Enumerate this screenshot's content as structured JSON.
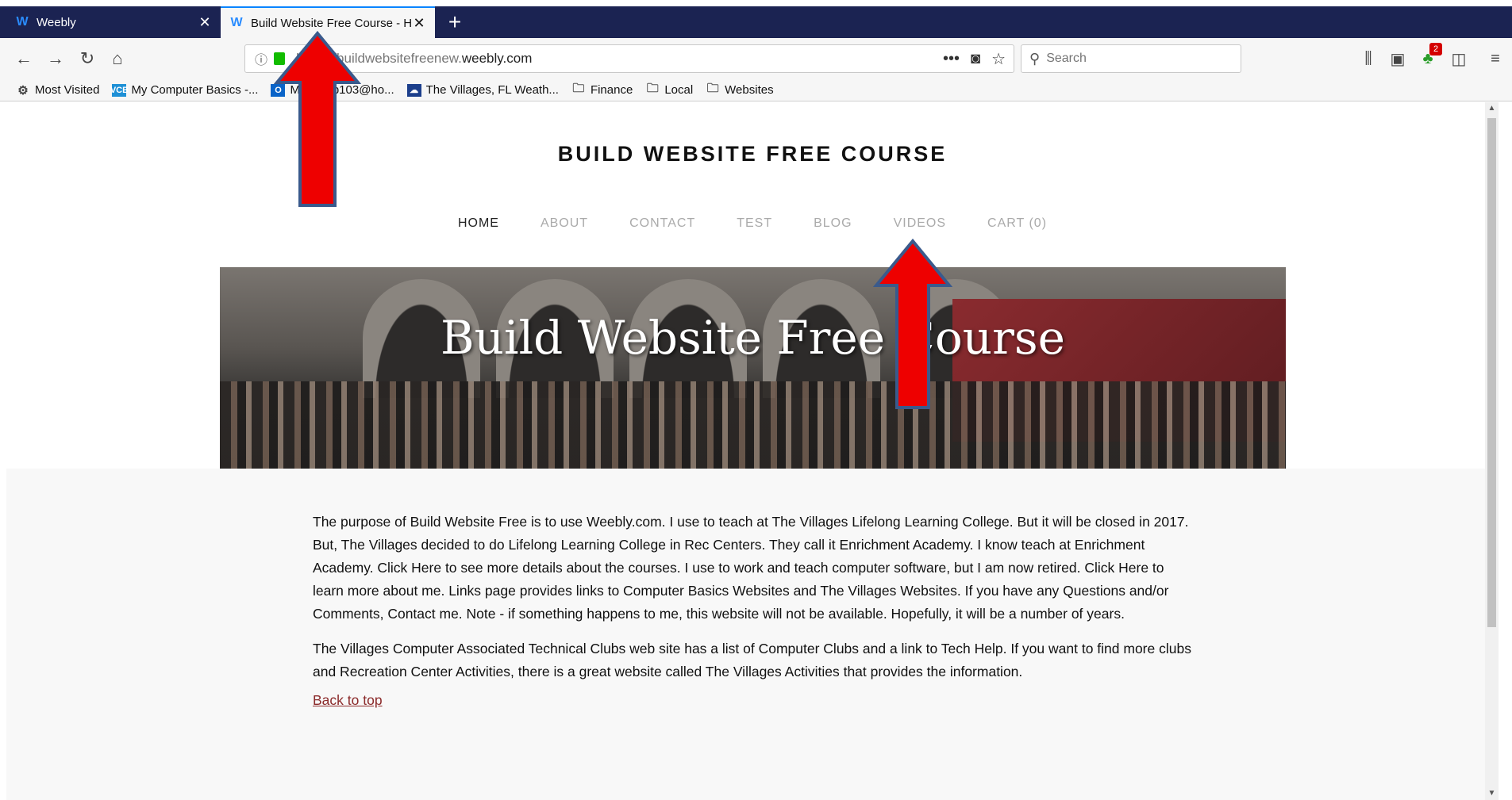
{
  "browser": {
    "tabs": [
      {
        "label": "Weebly",
        "active": false
      },
      {
        "label": "Build Website Free Course - Ho",
        "active": true
      }
    ],
    "url_prefix": "https://buildwebsitefreenew.",
    "url_domain": "weebly.com",
    "url_more": "•••",
    "search_placeholder": "Search",
    "notification_count": "2",
    "bookmarks": [
      {
        "label": "Most Visited",
        "icon": "gear-icon"
      },
      {
        "label": "My Computer Basics -...",
        "icon": "vcb-icon"
      },
      {
        "label": "Mail - fab103@ho...",
        "icon": "outlook-icon"
      },
      {
        "label": "The Villages, FL Weath...",
        "icon": "weather-icon"
      },
      {
        "label": "Finance",
        "icon": "folder-icon"
      },
      {
        "label": "Local",
        "icon": "folder-icon"
      },
      {
        "label": "Websites",
        "icon": "folder-icon"
      }
    ]
  },
  "site": {
    "title": "BUILD WEBSITE FREE COURSE",
    "nav": [
      "HOME",
      "ABOUT",
      "CONTACT",
      "TEST",
      "BLOG",
      "VIDEOS",
      "CART (0)"
    ],
    "banner_title": "Build Website Free Course",
    "paragraph1": "The purpose of Build Website Free is to use Weebly.com.  I use to teach at The Villages Lifelong Learning College. But it will be closed in 2017.  But, The Villages decided to do Lifelong Learning College in Rec Centers.  They call it Enrichment Academy. I know teach at Enrichment Academy.  Click Here to see more details about the courses.  I use to work and teach computer software, but I am now retired.  Click Here to learn more about me.  Links page provides links to Computer Basics Websites and The Villages Websites.  If you have any Questions and/or Comments, Contact me. Note - if something happens to me, this website will not be available.  Hopefully, it will be a number of years.",
    "paragraph2": "The Villages Computer  Associated Technical Clubs web site has a list of Computer Clubs and a link to Tech Help.  If you want to find more clubs and Recreation Center Activities, there is a great website called The Villages Activities that provides the information.",
    "back_to_top": "Back to top"
  },
  "colors": {
    "tabstrip": "#1b2352",
    "arrow_fill": "#ee0000",
    "arrow_stroke": "#3a5a8c",
    "link": "#8b2a2a"
  }
}
